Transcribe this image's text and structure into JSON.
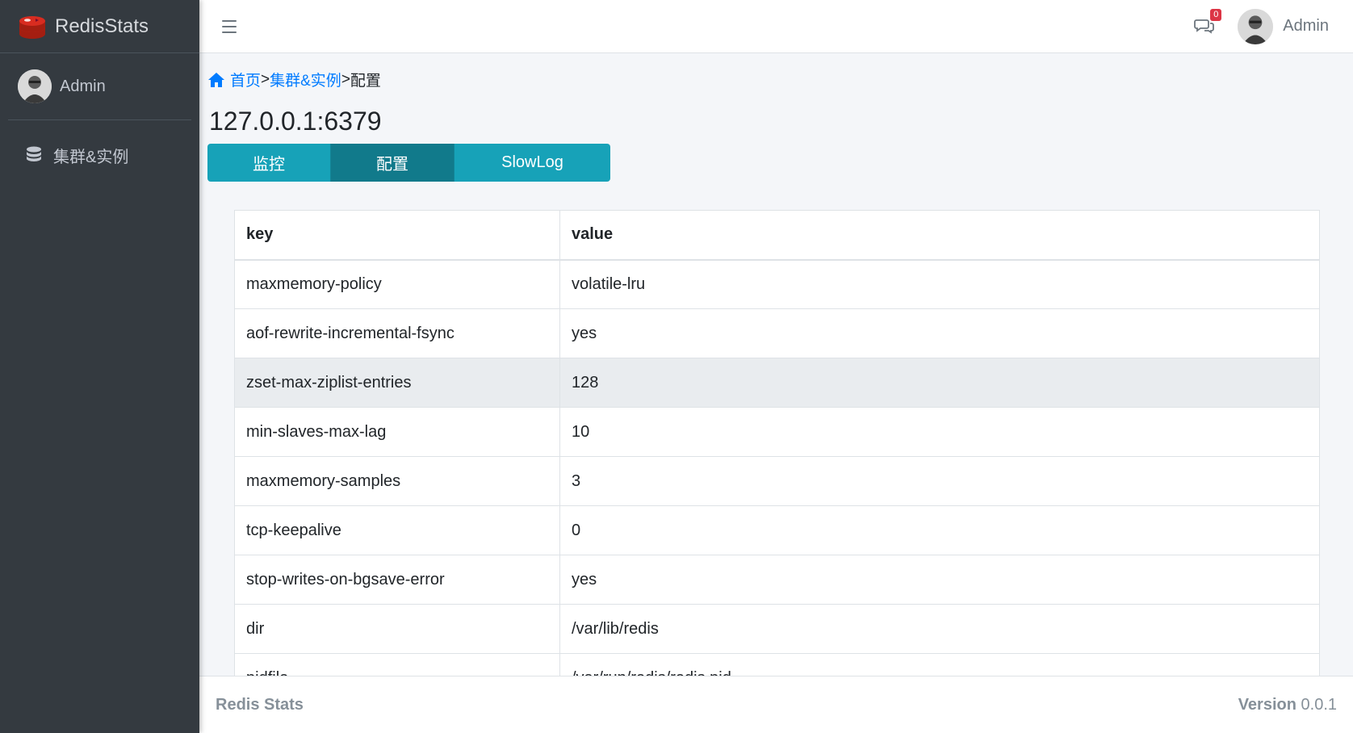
{
  "brand": {
    "name": "RedisStats"
  },
  "sidebar": {
    "user": "Admin",
    "items": [
      {
        "label": "集群&实例",
        "icon": "database-icon"
      }
    ]
  },
  "header": {
    "messages_badge": "0",
    "user": "Admin"
  },
  "breadcrumb": {
    "home": "首页",
    "sep1": ">",
    "clusters": "集群&实例",
    "sep2": ">",
    "current": "配置"
  },
  "page_title": "127.0.0.1:6379",
  "tabs": [
    {
      "label": "监控",
      "active": false
    },
    {
      "label": "配置",
      "active": true
    },
    {
      "label": "SlowLog",
      "active": false
    }
  ],
  "table": {
    "headers": [
      "key",
      "value"
    ],
    "rows": [
      [
        "maxmemory-policy",
        "volatile-lru"
      ],
      [
        "aof-rewrite-incremental-fsync",
        "yes"
      ],
      [
        "zset-max-ziplist-entries",
        "128"
      ],
      [
        "min-slaves-max-lag",
        "10"
      ],
      [
        "maxmemory-samples",
        "3"
      ],
      [
        "tcp-keepalive",
        "0"
      ],
      [
        "stop-writes-on-bgsave-error",
        "yes"
      ],
      [
        "dir",
        "/var/lib/redis"
      ],
      [
        "pidfile",
        "/var/run/redis/redis.pid"
      ]
    ]
  },
  "footer": {
    "app": "Redis Stats",
    "version_label": "Version",
    "version": "0.0.1"
  },
  "colors": {
    "sidebar": "#343a40",
    "tab": "#17a2b8",
    "tab_active": "#117a8b",
    "link": "#007bff",
    "badge": "#dc3545"
  }
}
